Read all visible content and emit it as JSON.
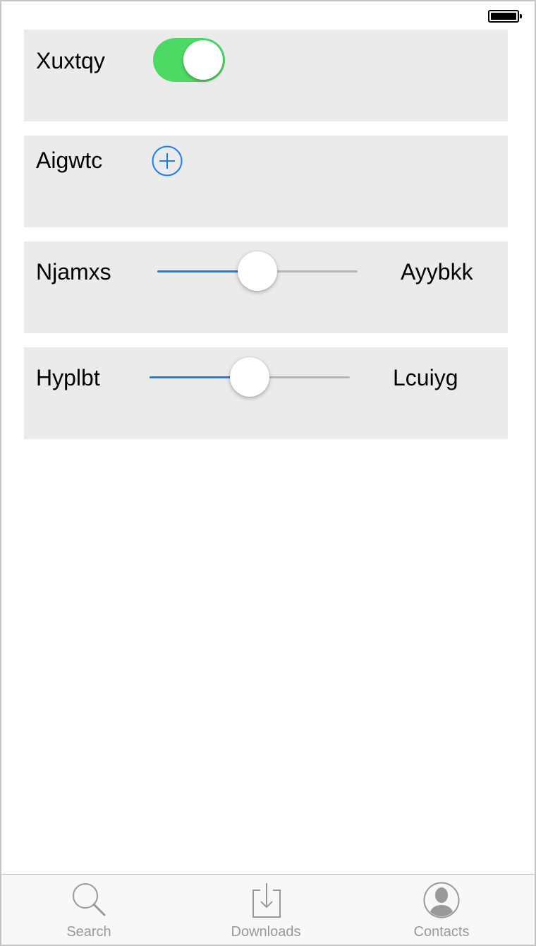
{
  "rows": [
    {
      "label": "Xuxtqy",
      "control": "toggle",
      "on": true
    },
    {
      "label": "Aigwtc",
      "control": "add-button",
      "icon": "plus-circle-icon"
    },
    {
      "label": "Njamxs",
      "control": "slider",
      "value_fraction": 0.5,
      "trailing_label": "Ayybkk"
    },
    {
      "label": "Hyplbt",
      "control": "slider",
      "value_fraction": 0.5,
      "trailing_label": "Lcuiyg"
    }
  ],
  "tabs": [
    {
      "label": "Search",
      "icon": "search-icon"
    },
    {
      "label": "Downloads",
      "icon": "download-icon"
    },
    {
      "label": "Contacts",
      "icon": "contact-icon"
    }
  ],
  "colors": {
    "toggle_on": "#4cd964",
    "accent": "#157efb",
    "panel_bg": "#ebebeb",
    "tab_inactive": "#999999"
  },
  "status_bar": {
    "battery_icon": "battery-icon"
  }
}
